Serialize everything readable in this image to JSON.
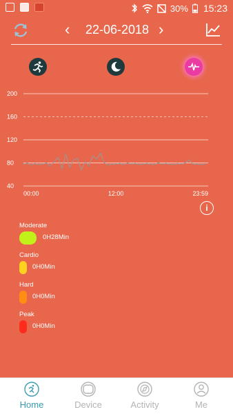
{
  "status_bar": {
    "battery_percent": "30%",
    "time": "15:23"
  },
  "header": {
    "date": "22-06-2018",
    "prev_glyph": "‹",
    "next_glyph": "›"
  },
  "modes": [
    {
      "icon": "running-icon",
      "active": false
    },
    {
      "icon": "sleep-moon-icon",
      "active": false
    },
    {
      "icon": "heart-pulse-icon",
      "active": true
    }
  ],
  "chart_data": {
    "type": "line",
    "title": "",
    "ylim": [
      40,
      210
    ],
    "y_ticks": [
      200,
      160,
      120,
      80,
      40
    ],
    "x_ticks": [
      "00:00",
      "12:00",
      "23:59"
    ],
    "threshold_line": 160,
    "grid": true,
    "series": [
      {
        "x": [
          "00:00",
          "00:30",
          "01:00",
          "01:30",
          "02:00",
          "02:30",
          "03:00",
          "03:30",
          "04:00",
          "04:30",
          "05:00",
          "05:30",
          "06:00",
          "06:30",
          "07:00",
          "07:30",
          "08:00",
          "08:30",
          "09:00",
          "09:30",
          "10:00",
          "10:30",
          "11:00",
          "11:30",
          "12:00",
          "12:30",
          "13:00",
          "13:30",
          "14:00",
          "14:30",
          "15:00",
          "15:30",
          "16:00",
          "16:30",
          "17:00",
          "17:30",
          "18:00",
          "18:30",
          "19:00",
          "19:30",
          "20:00",
          "20:30",
          "21:00",
          "21:30",
          "22:00",
          "22:30",
          "23:00",
          "23:30"
        ],
        "values": [
          78,
          80,
          76,
          79,
          77,
          78,
          80,
          75,
          82,
          90,
          70,
          95,
          72,
          85,
          88,
          68,
          82,
          75,
          92,
          86,
          97,
          80,
          76,
          78,
          78,
          79,
          77,
          80,
          78,
          79,
          77,
          78,
          79,
          78,
          77,
          80,
          78,
          79,
          78,
          77,
          79,
          78,
          80,
          85,
          78,
          78,
          77,
          78
        ]
      }
    ]
  },
  "info_glyph": "i",
  "zones": [
    {
      "label": "Moderate",
      "value": "0H28Min",
      "color": "#C2F11A"
    },
    {
      "label": "Cardio",
      "value": "0H0Min",
      "color": "#FFD21F"
    },
    {
      "label": "Hard",
      "value": "0H0Min",
      "color": "#FF8E12"
    },
    {
      "label": "Peak",
      "value": "0H0Min",
      "color": "#FF2B1C"
    }
  ],
  "tabs": [
    {
      "label": "Home",
      "active": true
    },
    {
      "label": "Device",
      "active": false
    },
    {
      "label": "Activity",
      "active": false
    },
    {
      "label": "Me",
      "active": false
    }
  ],
  "colors": {
    "background": "#E8674C",
    "accent": "#3A9BB0",
    "inactive": "#B3B3B3"
  }
}
